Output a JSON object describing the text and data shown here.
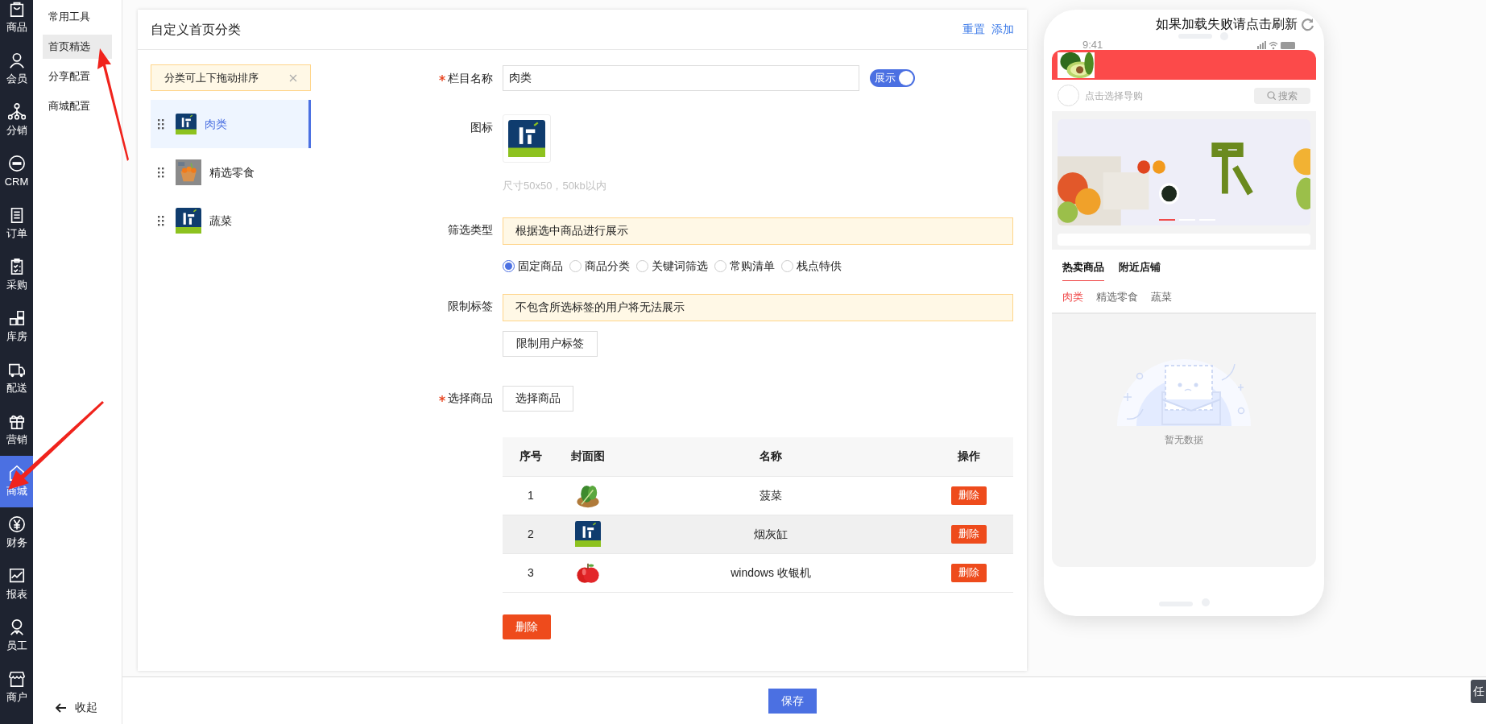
{
  "nav": {
    "items": [
      {
        "label": "商品",
        "selected": false
      },
      {
        "label": "会员",
        "selected": false
      },
      {
        "label": "分销",
        "selected": false
      },
      {
        "label": "CRM",
        "selected": false
      },
      {
        "label": "订单",
        "selected": false
      },
      {
        "label": "采购",
        "selected": false
      },
      {
        "label": "库房",
        "selected": false
      },
      {
        "label": "配送",
        "selected": false
      },
      {
        "label": "营销",
        "selected": false
      },
      {
        "label": "商城",
        "selected": true
      },
      {
        "label": "财务",
        "selected": false
      },
      {
        "label": "报表",
        "selected": false
      },
      {
        "label": "员工",
        "selected": false
      },
      {
        "label": "商户",
        "selected": false
      }
    ]
  },
  "submenu": {
    "items": [
      {
        "label": "常用工具",
        "selected": false
      },
      {
        "label": "首页精选",
        "selected": true
      },
      {
        "label": "分享配置",
        "selected": false
      },
      {
        "label": "商城配置",
        "selected": false
      }
    ],
    "collapse": "收起"
  },
  "card": {
    "title": "自定义首页分类",
    "actions": [
      "重置",
      "添加"
    ]
  },
  "categories": {
    "tip": "分类可上下拖动排序",
    "items": [
      {
        "name": "肉类",
        "selected": true
      },
      {
        "name": "精选零食",
        "selected": false
      },
      {
        "name": "蔬菜",
        "selected": false
      }
    ]
  },
  "form": {
    "name_field": {
      "label": "栏目名称",
      "required": true,
      "value": "肉类"
    },
    "display_toggle": {
      "label": "展示",
      "on": true
    },
    "icon_field": {
      "label": "图标",
      "hint": "尺寸50x50，50kb以内"
    },
    "filter_type": {
      "label": "筛选类型",
      "notice": "根据选中商品进行展示",
      "options": [
        {
          "label": "固定商品",
          "selected": true
        },
        {
          "label": "商品分类",
          "selected": false
        },
        {
          "label": "关键词筛选",
          "selected": false
        },
        {
          "label": "常购清单",
          "selected": false
        },
        {
          "label": "栈点特供",
          "selected": false
        }
      ]
    },
    "limit_tags": {
      "label": "限制标签",
      "notice": "不包含所选标签的用户将无法展示",
      "button": "限制用户标签"
    },
    "products": {
      "label": "选择商品",
      "required": true,
      "button": "选择商品"
    }
  },
  "table": {
    "columns": [
      "序号",
      "封面图",
      "名称",
      "操作"
    ],
    "rows": [
      {
        "index": "1",
        "name": "菠菜",
        "action": "删除",
        "hovered": false
      },
      {
        "index": "2",
        "name": "烟灰缸",
        "action": "删除",
        "hovered": true
      },
      {
        "index": "3",
        "name": "windows 收银机",
        "action": "删除",
        "hovered": false
      }
    ]
  },
  "bulk_delete": "删除",
  "save": "保存",
  "phone": {
    "refresh_text": "如果加载失败请点击刷新",
    "status_time": "9:41",
    "search_placeholder": "点击选择导购",
    "search_button": "搜索",
    "banner_dots": [
      {
        "selected": true
      },
      {
        "selected": false
      },
      {
        "selected": false
      }
    ],
    "tabs": [
      {
        "label": "热卖商品",
        "selected": true
      },
      {
        "label": "附近店铺",
        "selected": false
      }
    ],
    "subtabs": [
      {
        "label": "肉类",
        "selected": true
      },
      {
        "label": "精选零食",
        "selected": false
      },
      {
        "label": "蔬菜",
        "selected": false
      }
    ],
    "empty_text": "暂无数据"
  },
  "corner_tab": "任"
}
